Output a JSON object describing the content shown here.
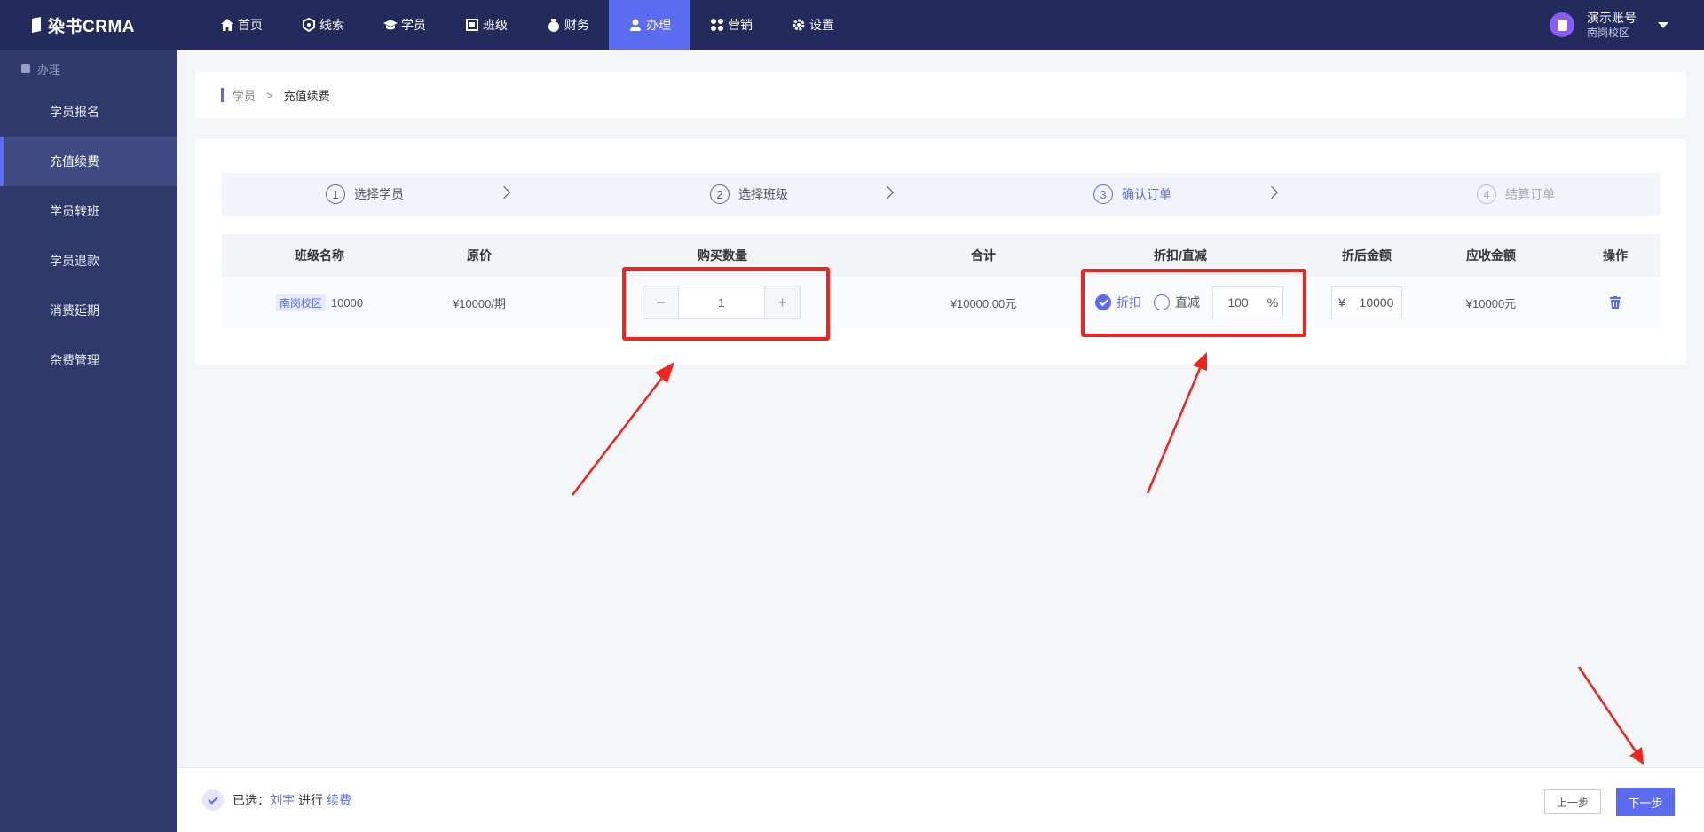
{
  "app": {
    "logo_text": "染书CRMA"
  },
  "nav": {
    "items": [
      {
        "label": "首页",
        "icon": "home-icon"
      },
      {
        "label": "线索",
        "icon": "clue-icon"
      },
      {
        "label": "学员",
        "icon": "student-icon"
      },
      {
        "label": "班级",
        "icon": "class-icon"
      },
      {
        "label": "财务",
        "icon": "finance-icon"
      },
      {
        "label": "办理",
        "icon": "handle-icon",
        "active": true
      },
      {
        "label": "营销",
        "icon": "marketing-icon"
      },
      {
        "label": "设置",
        "icon": "settings-icon"
      }
    ]
  },
  "user": {
    "name": "演示账号",
    "campus": "南岗校区"
  },
  "sidebar": {
    "section": "办理",
    "items": [
      {
        "label": "学员报名"
      },
      {
        "label": "充值续费",
        "active": true
      },
      {
        "label": "学员转班"
      },
      {
        "label": "学员退款"
      },
      {
        "label": "消费延期"
      },
      {
        "label": "杂费管理"
      }
    ]
  },
  "breadcrumb": {
    "parent": "学员",
    "separator": ">",
    "current": "充值续费"
  },
  "steps": [
    {
      "num": "1",
      "label": "选择学员",
      "state": "done"
    },
    {
      "num": "2",
      "label": "选择班级",
      "state": "done"
    },
    {
      "num": "3",
      "label": "确认订单",
      "state": "current"
    },
    {
      "num": "4",
      "label": "结算订单",
      "state": "future"
    }
  ],
  "table": {
    "headers": [
      "班级名称",
      "原价",
      "购买数量",
      "合计",
      "折扣/直减",
      "折后金额",
      "应收金额",
      "操作"
    ],
    "row": {
      "campus_tag": "南岗校区",
      "class_name": "10000",
      "price": "¥10000/期",
      "quantity": "1",
      "minus": "−",
      "plus": "+",
      "total": "¥10000.00元",
      "discount_label": "折扣",
      "reduce_label": "直减",
      "discount_value": "100",
      "discount_unit": "%",
      "currency": "¥",
      "after_discount": "10000",
      "receivable": "¥10000元"
    }
  },
  "footer": {
    "selected_prefix": "已选：",
    "student": "刘宇",
    "middle": "进行",
    "action": "续费",
    "prev_label": "上一步",
    "next_label": "下一步"
  },
  "colors": {
    "topbar": "#232a5c",
    "sidebar": "#2f3a6b",
    "accent": "#5b6cf0",
    "annotation": "#f2221d"
  }
}
